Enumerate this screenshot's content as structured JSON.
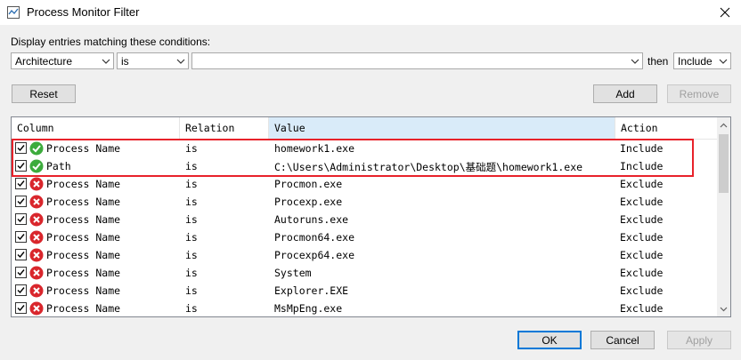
{
  "window": {
    "title": "Process Monitor Filter"
  },
  "conditions": {
    "label": "Display entries matching these conditions:",
    "column_value": "Architecture",
    "relation_value": "is",
    "value_value": "",
    "then_label": "then",
    "action_value": "Include"
  },
  "buttons": {
    "reset": "Reset",
    "add": "Add",
    "remove": "Remove",
    "ok": "OK",
    "cancel": "Cancel",
    "apply": "Apply"
  },
  "table": {
    "headers": {
      "column": "Column",
      "relation": "Relation",
      "value": "Value",
      "action": "Action"
    },
    "rows": [
      {
        "column": "Process Name",
        "relation": "is",
        "value": "homework1.exe",
        "action": "Include",
        "checked": true,
        "type": "include"
      },
      {
        "column": "Path",
        "relation": "is",
        "value": "C:\\Users\\Administrator\\Desktop\\基础题\\homework1.exe",
        "action": "Include",
        "checked": true,
        "type": "include"
      },
      {
        "column": "Process Name",
        "relation": "is",
        "value": "Procmon.exe",
        "action": "Exclude",
        "checked": true,
        "type": "exclude"
      },
      {
        "column": "Process Name",
        "relation": "is",
        "value": "Procexp.exe",
        "action": "Exclude",
        "checked": true,
        "type": "exclude"
      },
      {
        "column": "Process Name",
        "relation": "is",
        "value": "Autoruns.exe",
        "action": "Exclude",
        "checked": true,
        "type": "exclude"
      },
      {
        "column": "Process Name",
        "relation": "is",
        "value": "Procmon64.exe",
        "action": "Exclude",
        "checked": true,
        "type": "exclude"
      },
      {
        "column": "Process Name",
        "relation": "is",
        "value": "Procexp64.exe",
        "action": "Exclude",
        "checked": true,
        "type": "exclude"
      },
      {
        "column": "Process Name",
        "relation": "is",
        "value": "System",
        "action": "Exclude",
        "checked": true,
        "type": "exclude"
      },
      {
        "column": "Process Name",
        "relation": "is",
        "value": "Explorer.EXE",
        "action": "Exclude",
        "checked": true,
        "type": "exclude"
      },
      {
        "column": "Process Name",
        "relation": "is",
        "value": "MsMpEng.exe",
        "action": "Exclude",
        "checked": true,
        "type": "exclude"
      }
    ]
  },
  "colors": {
    "include_icon": "#3cab3c",
    "exclude_icon": "#d9262c",
    "highlight_border": "#e8222a",
    "sorted_header": "#d9ebf9"
  }
}
